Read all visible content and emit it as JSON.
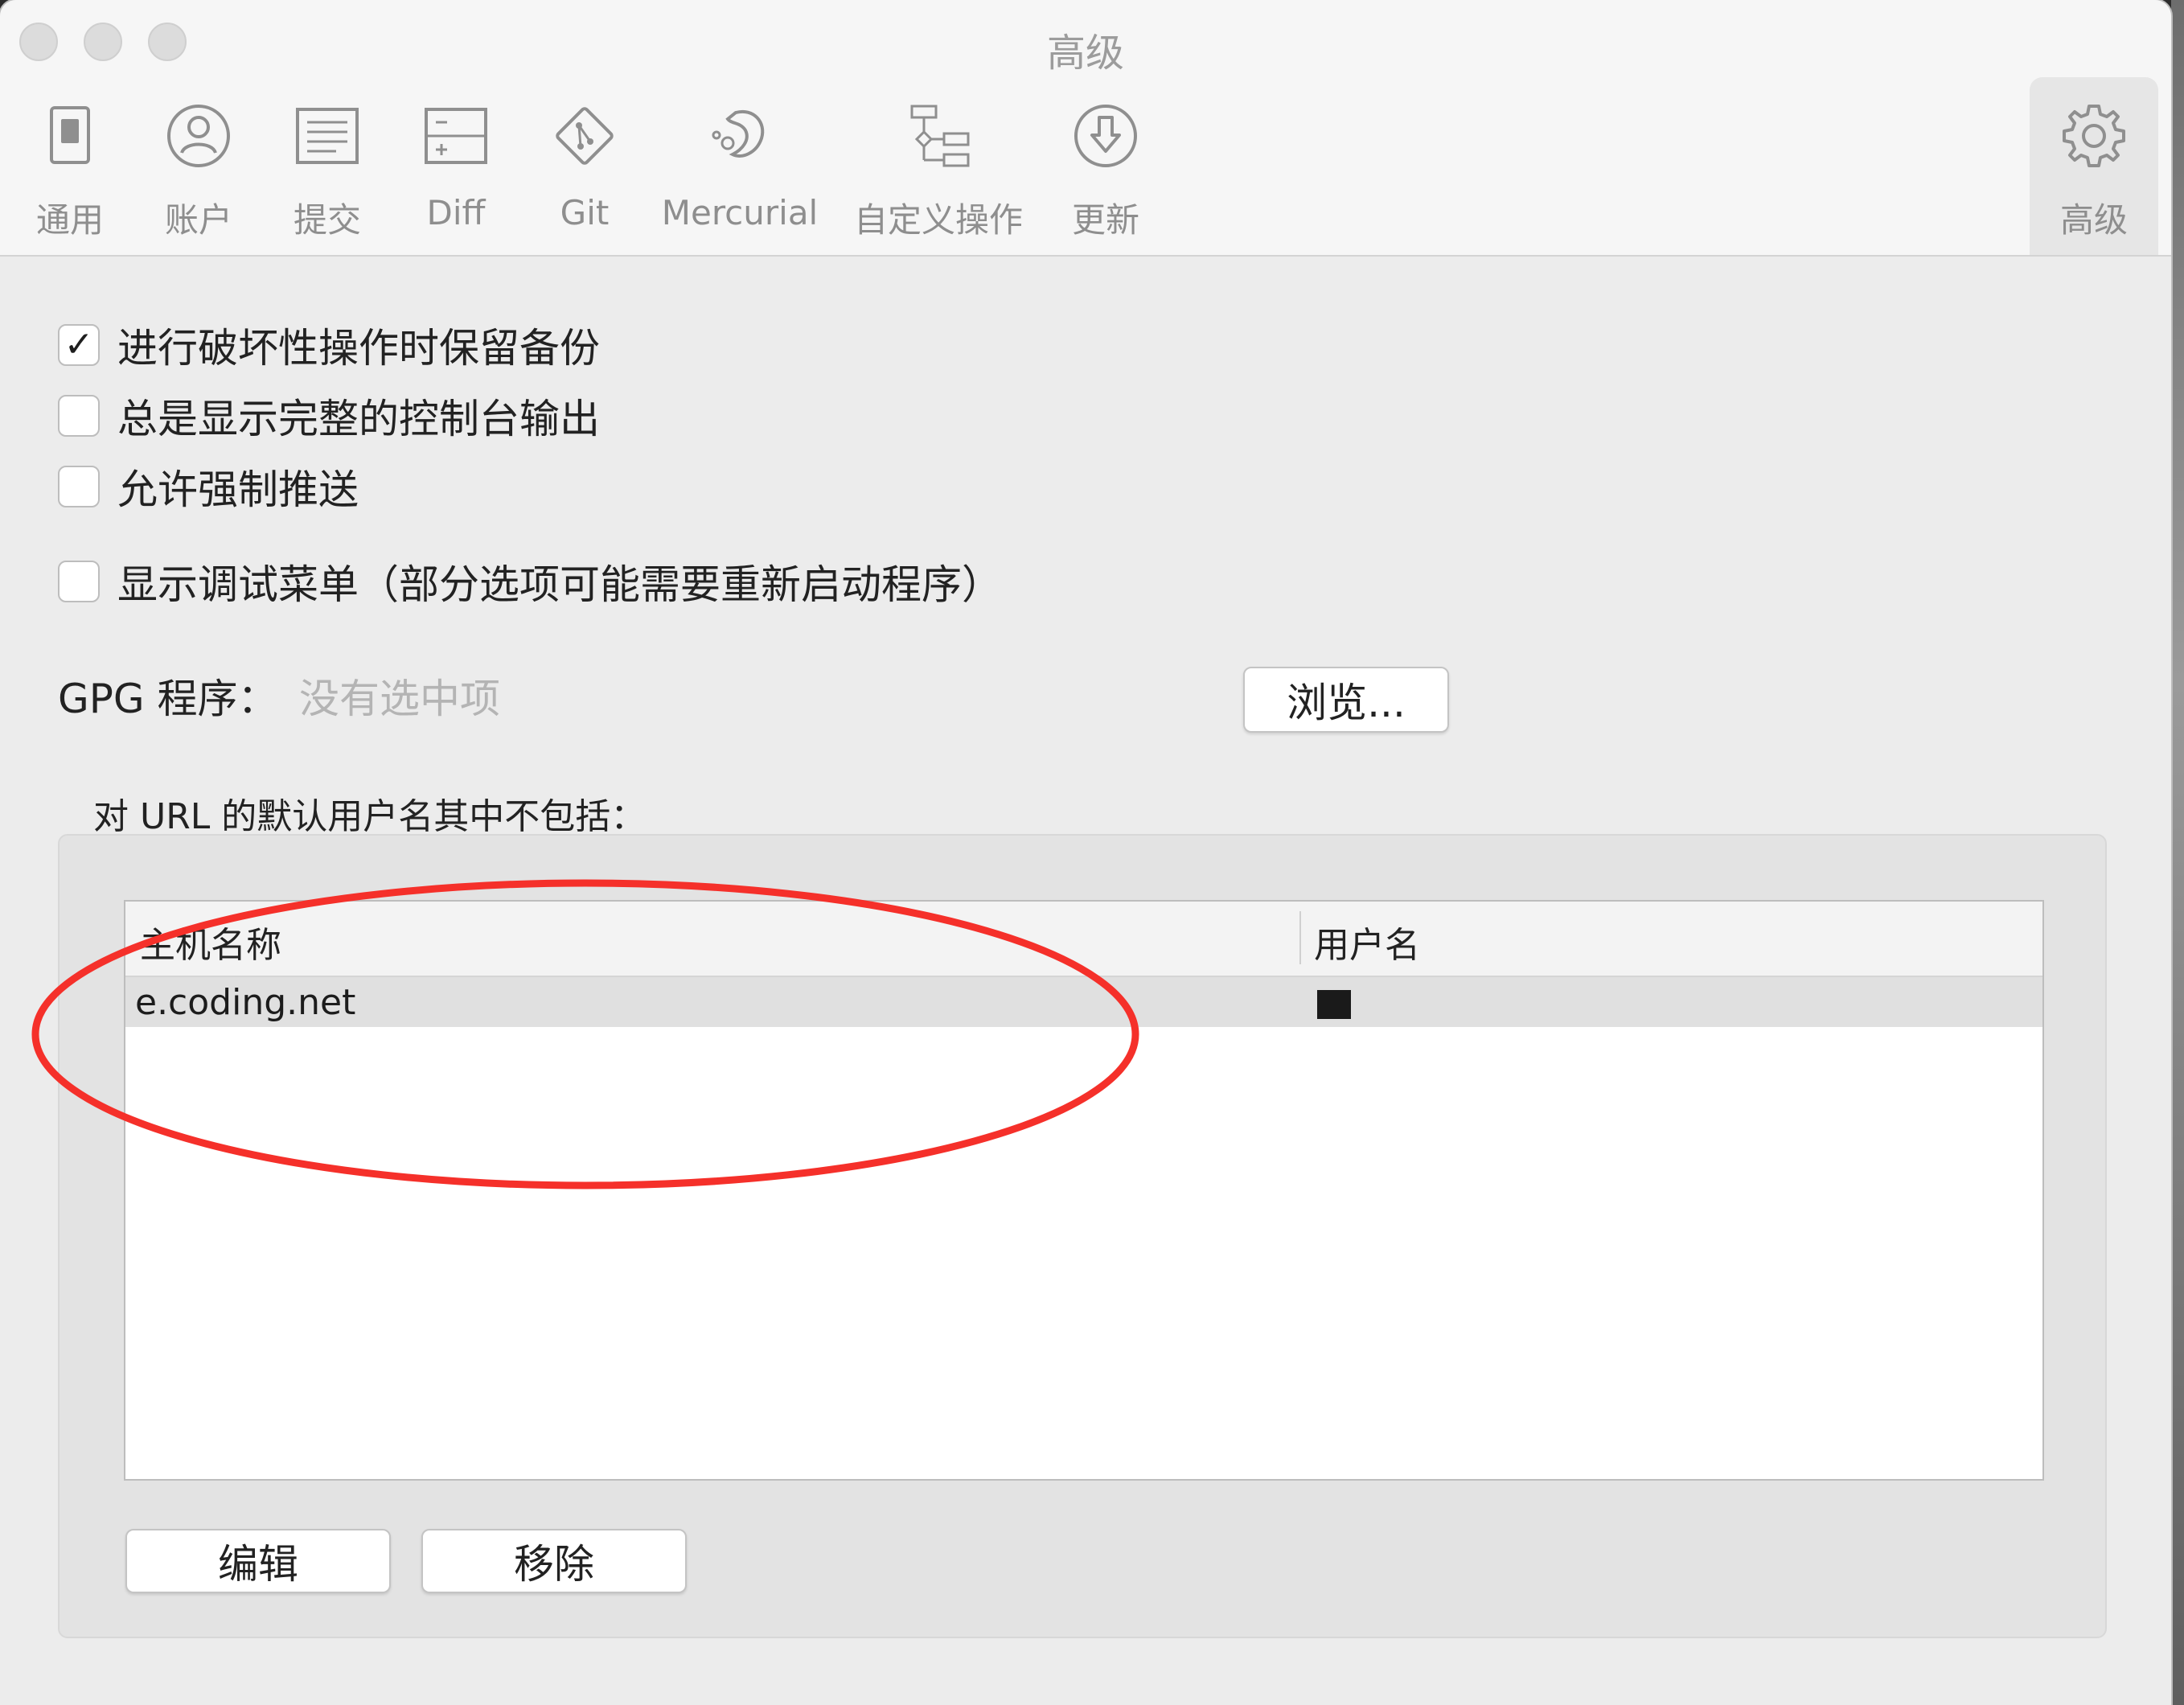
{
  "window": {
    "title": "高级"
  },
  "toolbar": {
    "items": [
      {
        "label": "通用",
        "icon": "general-switch-icon"
      },
      {
        "label": "账户",
        "icon": "account-person-icon"
      },
      {
        "label": "提交",
        "icon": "commit-document-icon"
      },
      {
        "label": "Diff",
        "icon": "diff-icon"
      },
      {
        "label": "Git",
        "icon": "git-icon"
      },
      {
        "label": "Mercurial",
        "icon": "mercurial-icon"
      },
      {
        "label": "自定义操作",
        "icon": "custom-actions-icon"
      },
      {
        "label": "更新",
        "icon": "update-download-icon"
      },
      {
        "label": "高级",
        "icon": "gear-icon",
        "selected": true
      }
    ]
  },
  "options": [
    {
      "label": "进行破坏性操作时保留备份",
      "checked": true,
      "mark": "✓"
    },
    {
      "label": "总是显示完整的控制台输出",
      "checked": false
    },
    {
      "label": "允许强制推送",
      "checked": false
    },
    {
      "label": "显示调试菜单（部分选项可能需要重新启动程序）",
      "checked": false
    }
  ],
  "gpg": {
    "label": "GPG 程序：",
    "value": "没有选中项",
    "browse_label": "浏览..."
  },
  "url_defaults": {
    "title": "对 URL 的默认用户名其中不包括：",
    "columns": [
      "主机名称",
      "用户名"
    ],
    "rows": [
      {
        "host": "e.coding.net",
        "user_redacted": true
      }
    ],
    "edit_label": "编辑",
    "remove_label": "移除"
  },
  "colors": {
    "annotation": "#f5302a"
  }
}
